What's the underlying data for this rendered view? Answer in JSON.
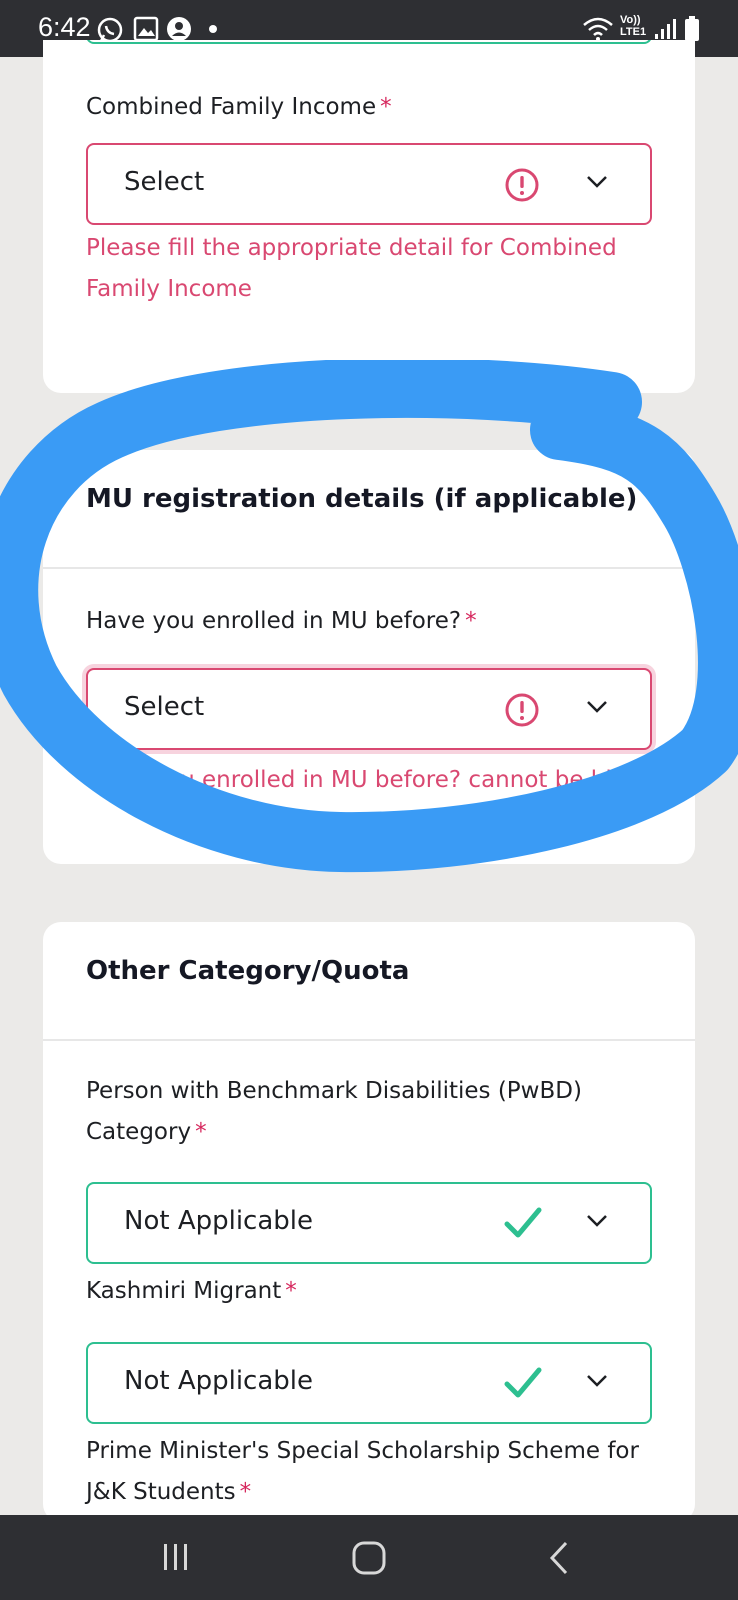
{
  "status_bar": {
    "time": "6:42",
    "volte_top": "Vo))",
    "volte_bottom": "LTE1",
    "icons": [
      "whatsapp-icon",
      "gallery-icon",
      "account-icon",
      "dot-icon",
      "wifi-icon",
      "signal-icon",
      "battery-icon"
    ]
  },
  "income_section": {
    "label": "Combined Family Income",
    "required_mark": "*",
    "select_value": "Select",
    "error": "Please fill the appropriate detail for Combined Family Income"
  },
  "mu_section": {
    "title": "MU registration details (if applicable)",
    "label": "Have you enrolled in MU before?",
    "required_mark": "*",
    "select_value": "Select",
    "error": "Have you enrolled in MU before? cannot be blank"
  },
  "other_section": {
    "title": "Other Category/Quota",
    "pwbd_label": "Person with Benchmark Disabilities (PwBD) Category",
    "pwbd_value": "Not Applicable",
    "kashmiri_label": "Kashmiri Migrant",
    "kashmiri_value": "Not Applicable",
    "pm_label": "Prime Minister's Special Scholarship Scheme for J&K Students",
    "required_mark": "*"
  },
  "colors": {
    "error": "#d94871",
    "valid": "#2dbf90",
    "annotation": "#3a9bf5"
  },
  "nav_bar": {
    "icons": [
      "recent-apps-icon",
      "home-icon",
      "back-icon"
    ]
  }
}
